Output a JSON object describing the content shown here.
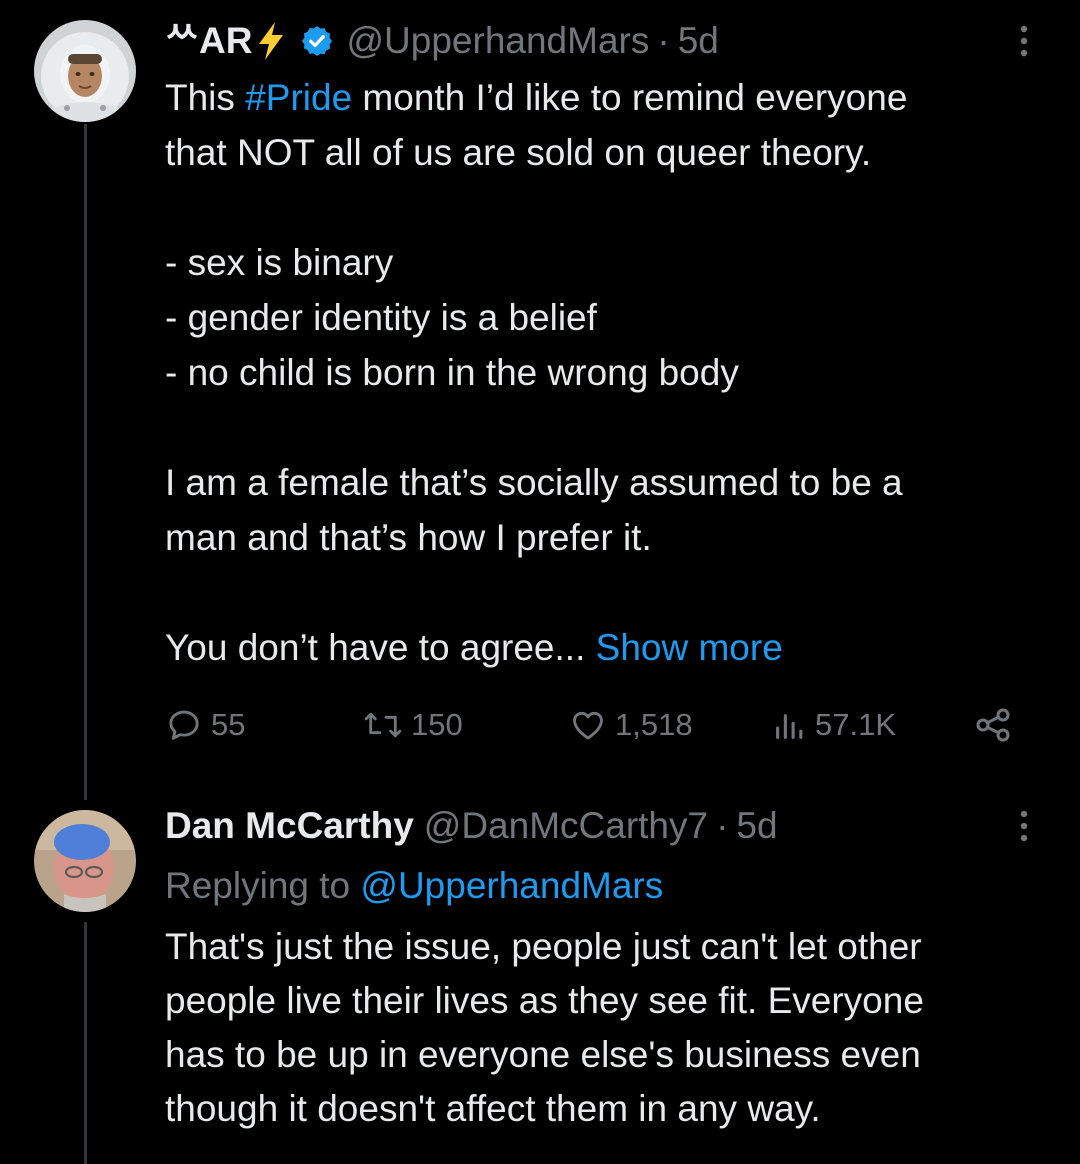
{
  "colors": {
    "background": "#000000",
    "text": "#e7e9ea",
    "muted": "#71767b",
    "accent": "#1d9bf0",
    "verified": "#1d9bf0",
    "thread_line": "#333639"
  },
  "main_tweet": {
    "display_name": "ᄊAR",
    "emoji_icon": "lightning-emoji",
    "verified_icon": "verified-badge-icon",
    "handle": "@UpperhandMars",
    "separator": "·",
    "time": "5d",
    "more_icon": "more-vertical-icon",
    "text": {
      "line1_prefix": "This ",
      "hashtag": "#Pride",
      "line1_suffix": " month I’d like to remind everyone",
      "line2": "that NOT all of us are sold on queer theory.",
      "list": [
        "- sex is binary",
        "- gender identity is a belief",
        "- no child is born in the wrong body"
      ],
      "para2_line1": "I am a female that’s socially assumed to be a",
      "para2_line2": "man and that’s how I prefer it.",
      "truncated": "You don’t have to agree...",
      "show_more": "Show more"
    },
    "stats": {
      "replies": "55",
      "retweets": "150",
      "likes": "1,518",
      "views": "57.1K"
    },
    "action_icons": [
      "reply-icon",
      "retweet-icon",
      "like-icon",
      "views-icon",
      "share-icon"
    ]
  },
  "reply_tweet": {
    "display_name": "Dan McCarthy",
    "handle": "@DanMcCarthy7",
    "separator": "·",
    "time": "5d",
    "more_icon": "more-vertical-icon",
    "replying_to_label": "Replying to",
    "replying_to_handle": "@UpperhandMars",
    "text_lines": [
      "That's just the issue, people just can't let other",
      "people live their lives as they see fit. Everyone",
      "has to be up in everyone else's business even",
      "though it doesn't affect them in any way."
    ]
  }
}
